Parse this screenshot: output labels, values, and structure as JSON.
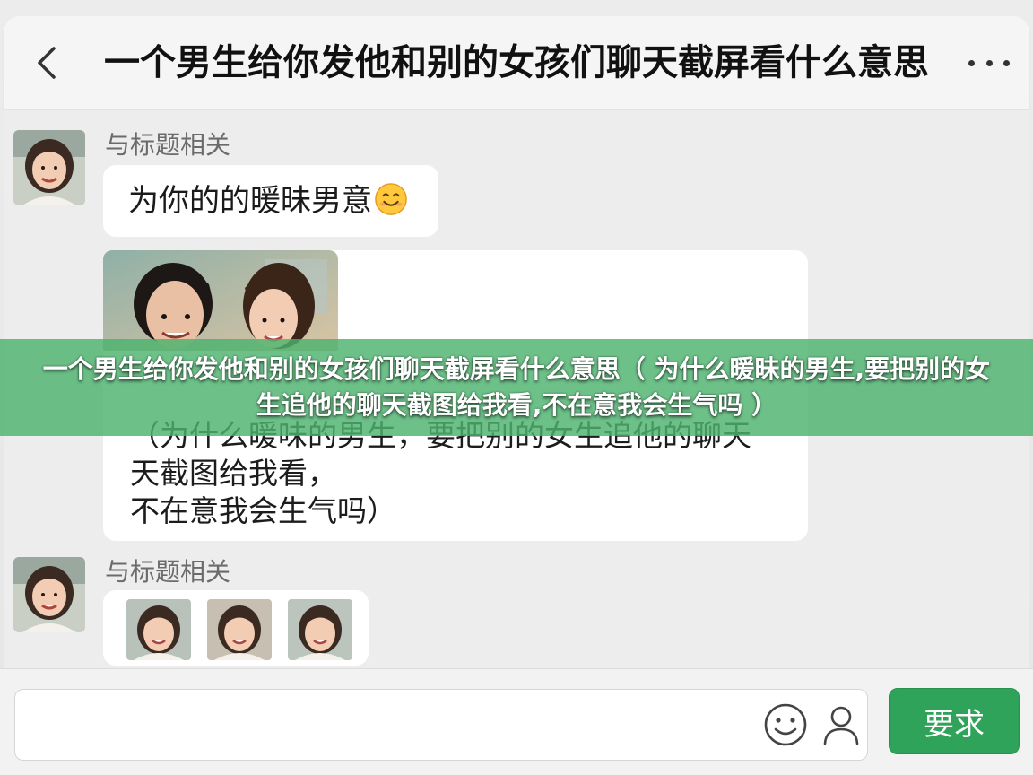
{
  "header": {
    "title": "一个男生给你发他和别的女孩们聊天截屏看什么意思",
    "back_icon": "chevron-left-icon",
    "more_icon": "more-dots-icon"
  },
  "messages": [
    {
      "sender": "与标题相关",
      "text": "为你的的暖昧男意",
      "emoji": "smiling-face-icon"
    },
    {
      "text": "（为什么暖味的男生，要把别的女生追他的聊天\n 天截图给我看，\n不在意我会生气吗）"
    },
    {
      "sender": "与标题相关",
      "thumbnails": [
        "girl-photo-1",
        "girl-photo-2",
        "girl-photo-3"
      ]
    }
  ],
  "banner": {
    "text": "一个男生给你发他和别的女孩们聊天截屏看什么意思（ 为什么暖昧的男生,要把别的女生追他的聊天截图给我看,不在意我会生气吗 ）"
  },
  "input_bar": {
    "placeholder": "",
    "emoji_icon": "emoji-icon",
    "user_icon": "user-icon",
    "send_label": "要求"
  },
  "colors": {
    "accent": "#2fa35a",
    "banner": "#4cb26e",
    "bubble": "#ffffff",
    "background": "#ededed"
  }
}
